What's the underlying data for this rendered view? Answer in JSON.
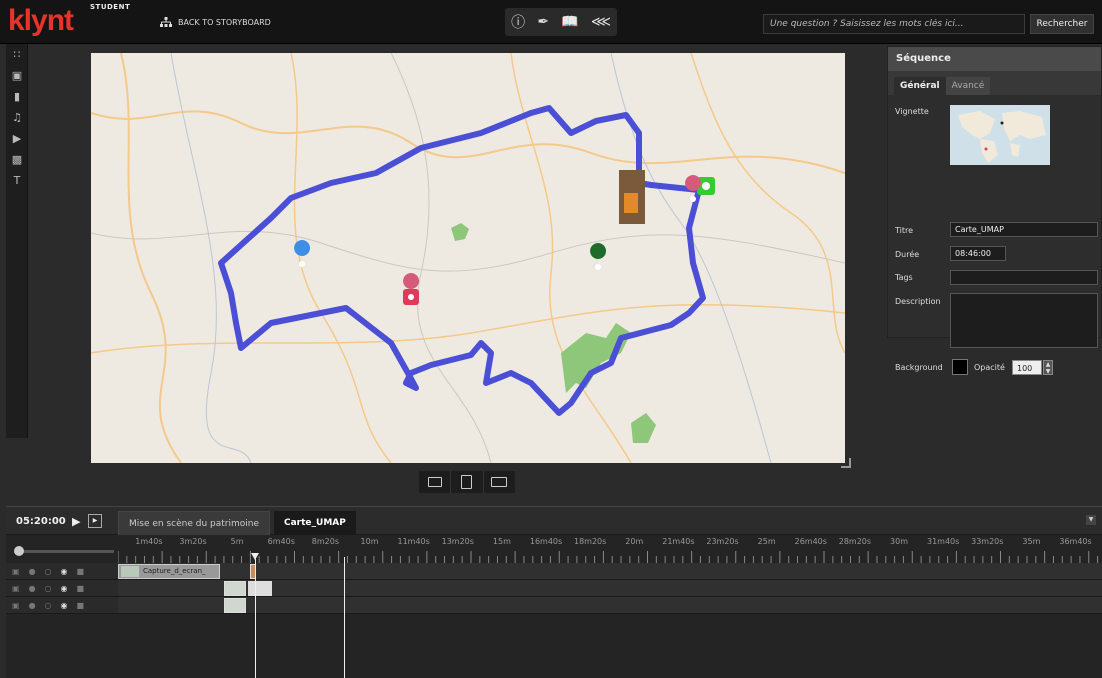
{
  "app": {
    "logo": "klynt",
    "logo_sub": "STUDENT",
    "back_label": "BACK TO STORYBOARD"
  },
  "toolbar": {
    "icons": [
      "info-icon",
      "brush-icon",
      "book-icon",
      "share-icon"
    ]
  },
  "search": {
    "placeholder": "Une question ? Saisissez les mots clés ici...",
    "button_label": "Rechercher"
  },
  "left_tools": [
    "grid-icon",
    "camera-icon",
    "video-icon",
    "music-icon",
    "play-icon",
    "image-icon",
    "text-icon"
  ],
  "panel": {
    "title": "Séquence",
    "tabs": [
      "Général",
      "Avancé"
    ],
    "active_tab": "Général",
    "vignette_label": "Vignette",
    "titre_label": "Titre",
    "titre_value": "Carte_UMAP",
    "duree_label": "Durée",
    "duree_value": "08:46:00",
    "tags_label": "Tags",
    "tags_value": "",
    "description_label": "Description",
    "description_value": "",
    "background_label": "Background",
    "background_color": "#000000",
    "opacite_label": "Opacité",
    "opacite_value": "100"
  },
  "timeline": {
    "timecode": "05:20:00",
    "tabs": [
      "Mise en scène du patrimoine",
      "Carte_UMAP"
    ],
    "active_tab": "Carte_UMAP",
    "ruler_labels": [
      "1m40s",
      "3m20s",
      "5m",
      "6m40s",
      "8m20s",
      "10m",
      "11m40s",
      "13m20s",
      "15m",
      "16m40s",
      "18m20s",
      "20m",
      "21m40s",
      "23m20s",
      "25m",
      "26m40s",
      "28m20s",
      "30m",
      "31m40s",
      "33m20s",
      "35m",
      "36m40s"
    ],
    "clip_label": "Capture_d_ecran_"
  },
  "colors": {
    "route": "#4a4fd6",
    "brand": "#e8332a",
    "marker_blue": "#3d8ee8",
    "marker_pink": "#d65a7a",
    "marker_green": "#1f6b2a",
    "marker_lime": "#33cc33"
  }
}
